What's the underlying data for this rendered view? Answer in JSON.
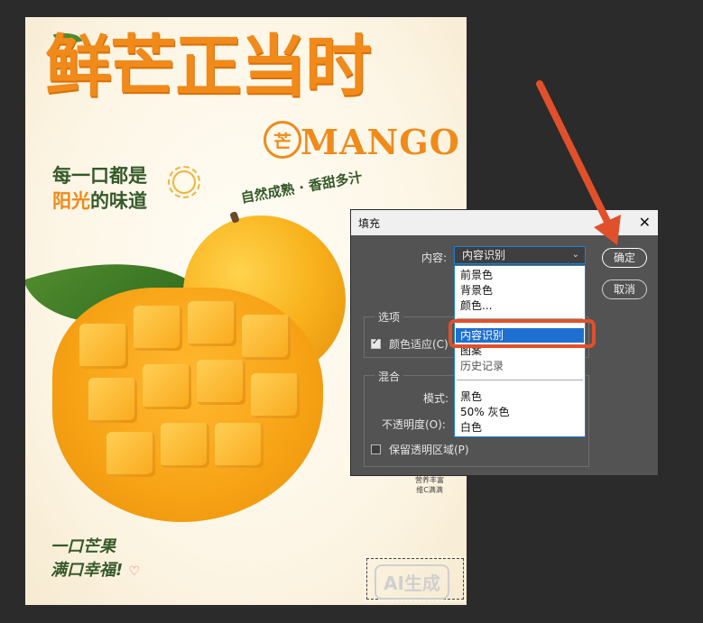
{
  "poster": {
    "title_cn": "鲜芒正当时",
    "badge_char": "芒",
    "title_en": "MANGO",
    "slogan_top_line1": "每一口都是",
    "slogan_top_hl": "阳光",
    "slogan_top_rest": "的味道",
    "slogan_right": "自然成熟 · 香甜多汁",
    "slogan_bottom_line1": "一口芒果",
    "slogan_bottom_line2": "满口幸福!",
    "heart": "♡",
    "nutri_line1": "营养丰富",
    "nutri_line2": "维C满满",
    "ai_badge": "AI生成"
  },
  "dialog": {
    "title": "填充",
    "close_glyph": "✕",
    "content_label": "内容:",
    "content_value": "内容识别",
    "ok_label": "确定",
    "cancel_label": "取消",
    "options_title": "选项",
    "color_adapt_label": "颜色适应(C)",
    "blend_title": "混合",
    "mode_label": "模式:",
    "opacity_label": "不透明度(O):",
    "preserve_label": "保留透明区域(P)",
    "dropdown_items": {
      "foreground": "前景色",
      "background": "背景色",
      "color": "颜色...",
      "content_aware": "内容识别",
      "pattern": "图案",
      "history": "历史记录",
      "black": "黑色",
      "gray": "50% 灰色",
      "white": "白色"
    }
  },
  "colors": {
    "accent_orange": "#f08a1a",
    "annotation_red": "#e0502a",
    "selection_blue": "#1f6fd0",
    "dialog_bg": "#535353",
    "app_bg": "#2b2b2b"
  }
}
